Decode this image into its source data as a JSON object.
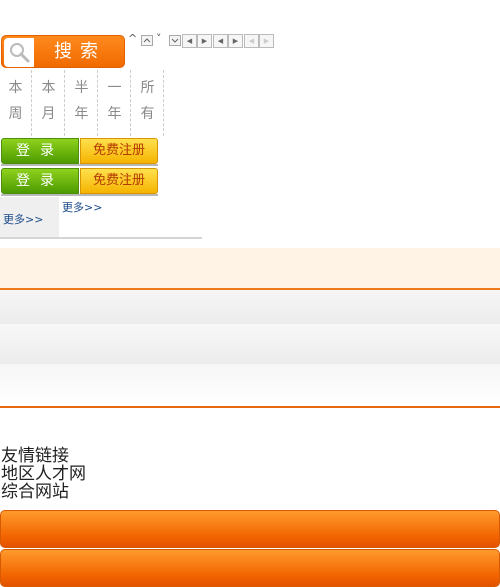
{
  "search": {
    "label": "搜索",
    "icon": "magnifier-icon"
  },
  "sort_arrows": [
    "^",
    "˅"
  ],
  "periods": [
    {
      "top": "本",
      "bottom": "周"
    },
    {
      "top": "本",
      "bottom": "月"
    },
    {
      "top": "半",
      "bottom": "年"
    },
    {
      "top": "一",
      "bottom": "年"
    },
    {
      "top": "所",
      "bottom": "有"
    }
  ],
  "auth": {
    "login_label": "登录",
    "register_label": "免费注册"
  },
  "more_label": "更多>>",
  "footer": {
    "friend_links": "友情链接",
    "regional_talent": "地区人才网",
    "general_sites": "综合网站"
  }
}
